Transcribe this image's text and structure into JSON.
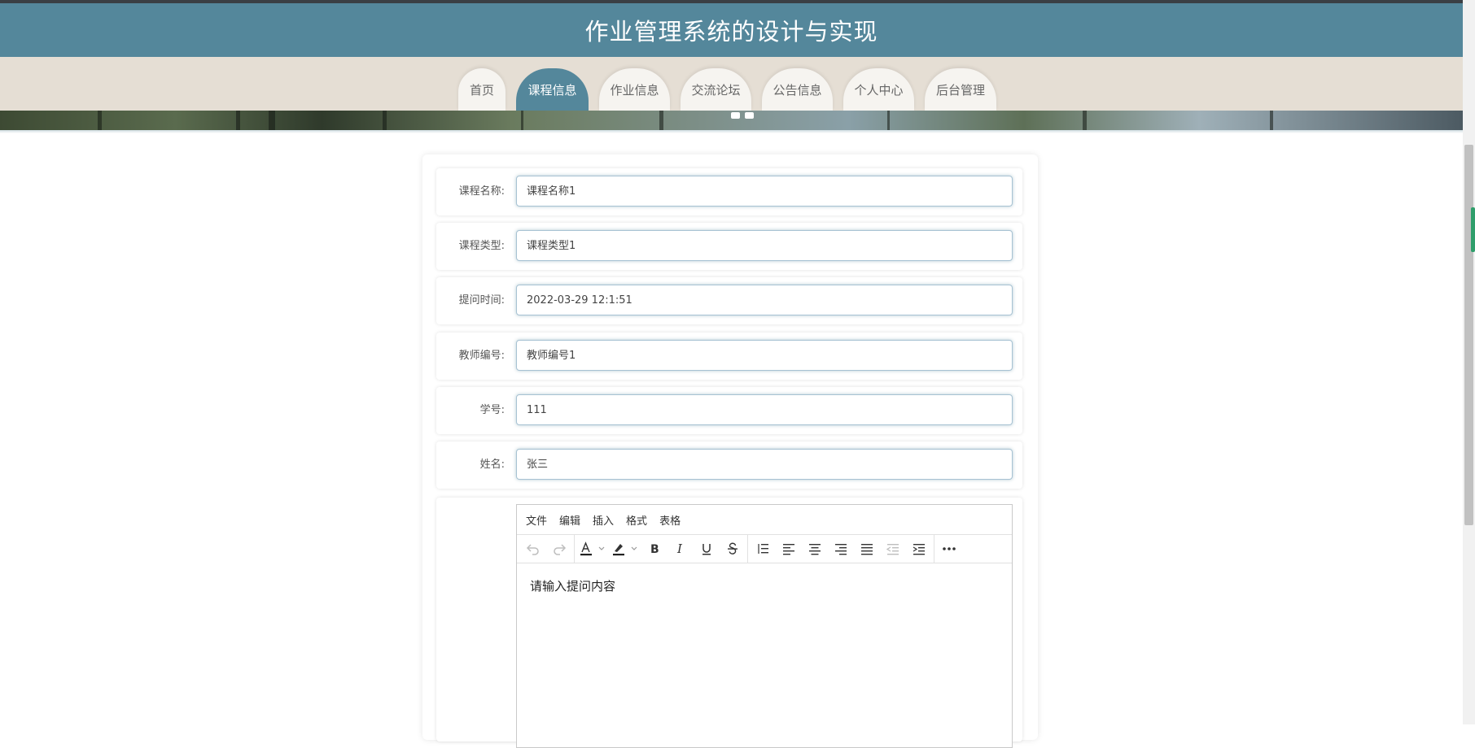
{
  "header": {
    "title": "作业管理系统的设计与实现"
  },
  "nav": {
    "items": [
      "首页",
      "课程信息",
      "作业信息",
      "交流论坛",
      "公告信息",
      "个人中心",
      "后台管理"
    ],
    "active": "课程信息"
  },
  "form": {
    "fields": [
      {
        "label": "课程名称:",
        "value": "课程名称1"
      },
      {
        "label": "课程类型:",
        "value": "课程类型1"
      },
      {
        "label": "提问时间:",
        "value": "2022-03-29 12:1:51"
      },
      {
        "label": "教师编号:",
        "value": "教师编号1"
      },
      {
        "label": "学号:",
        "value": "111"
      },
      {
        "label": "姓名:",
        "value": "张三"
      }
    ]
  },
  "editor": {
    "menu": [
      "文件",
      "编辑",
      "插入",
      "格式",
      "表格"
    ],
    "placeholder": "请输入提问内容",
    "toolbar_icons": [
      "undo-icon",
      "redo-icon",
      "font-color-icon",
      "highlight-color-icon",
      "bold-icon",
      "italic-icon",
      "underline-icon",
      "strikethrough-icon",
      "line-height-icon",
      "align-left-icon",
      "align-center-icon",
      "align-right-icon",
      "align-justify-icon",
      "outdent-icon",
      "indent-icon",
      "more-icon"
    ]
  },
  "colors": {
    "header_bg": "#54879b",
    "nav_bg": "#e5ded4",
    "field_border": "#a7c2d3"
  }
}
